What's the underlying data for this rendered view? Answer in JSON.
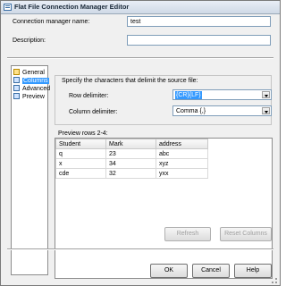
{
  "window": {
    "title": "Flat File Connection Manager Editor"
  },
  "form": {
    "name_label": "Connection manager name:",
    "name_value": "test",
    "description_label": "Description:",
    "description_value": ""
  },
  "nav": {
    "items": [
      {
        "label": "General",
        "selected": false
      },
      {
        "label": "Columns",
        "selected": true
      },
      {
        "label": "Advanced",
        "selected": false
      },
      {
        "label": "Preview",
        "selected": false
      }
    ]
  },
  "delimiters": {
    "caption": "Specify the characters that delimit the source file:",
    "row_label": "Row delimiter:",
    "row_value": "{CR}{LF}",
    "column_label": "Column delimiter:",
    "column_value": "Comma {,}"
  },
  "preview": {
    "label": "Preview rows 2-4:",
    "columns": [
      "Student",
      "Mark",
      "address"
    ],
    "rows": [
      [
        "q",
        "23",
        "abc"
      ],
      [
        "x",
        "34",
        "xyz"
      ],
      [
        "cde",
        "32",
        "yxx"
      ]
    ]
  },
  "buttons": {
    "refresh": "Refresh",
    "reset_columns": "Reset Columns",
    "ok": "OK",
    "cancel": "Cancel",
    "help": "Help"
  }
}
